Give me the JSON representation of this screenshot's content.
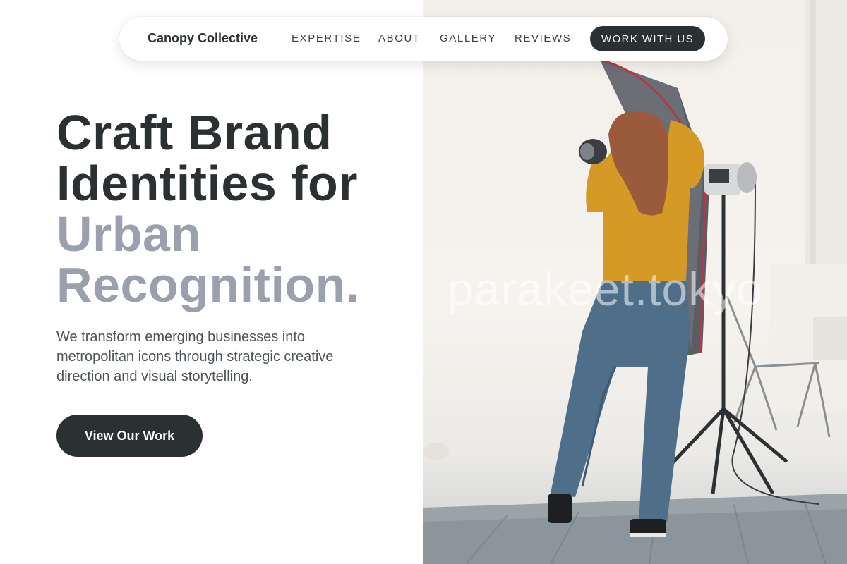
{
  "nav": {
    "brand": "Canopy Collective",
    "links": [
      "EXPERTISE",
      "ABOUT",
      "GALLERY",
      "REVIEWS"
    ],
    "cta_label": "WORK WITH US"
  },
  "hero": {
    "headline_line1": "Craft Brand",
    "headline_line2": "Identities for",
    "headline_line3": "Urban",
    "headline_line4": "Recognition.",
    "subtext": "We transform emerging businesses into metropolitan icons through strategic creative direction and visual storytelling.",
    "cta_label": "View Our Work"
  },
  "photo": {
    "watermark": "parakeet.tokyo"
  },
  "colors": {
    "dark": "#2b3133",
    "muted_headline": "#9aa0ad",
    "body_text": "#4b5357"
  }
}
